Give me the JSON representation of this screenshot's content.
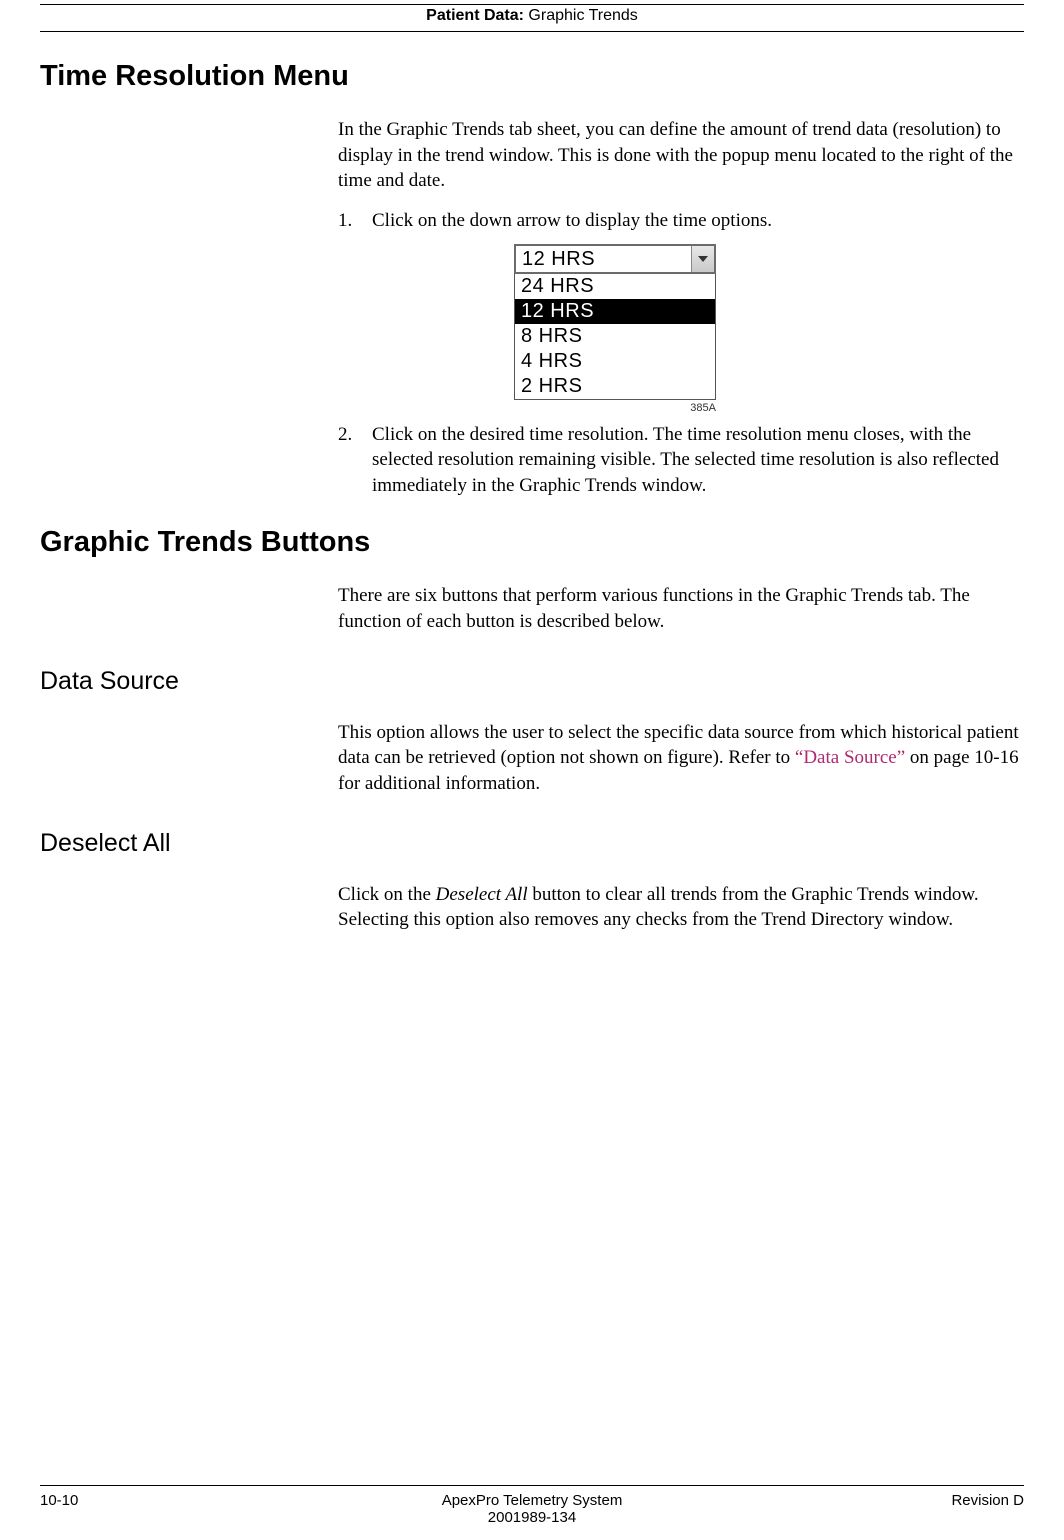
{
  "header": {
    "section_label": "Patient Data:",
    "section_value": "Graphic Trends"
  },
  "sections": {
    "time_resolution": {
      "title": "Time Resolution Menu",
      "intro": "In the Graphic Trends tab sheet, you can define the amount of trend data (resolution) to display in the trend window. This is done with the popup menu located to the right of the time and date.",
      "step1_num": "1.",
      "step1_text": "Click on the down arrow to display the time options.",
      "dropdown": {
        "selected": "12 HRS",
        "options": [
          "24 HRS",
          "12 HRS",
          "8 HRS",
          "4 HRS",
          "2 HRS"
        ],
        "highlighted_index": 1
      },
      "fig_caption": "385A",
      "step2_num": "2.",
      "step2_text": "Click on the desired time resolution. The time resolution menu closes, with the selected resolution remaining visible. The selected time resolution is also reflected immediately in the Graphic Trends window."
    },
    "graphic_trends_buttons": {
      "title": "Graphic Trends Buttons",
      "intro": "There are six buttons that perform various functions in the Graphic Trends tab. The function of each button is described below."
    },
    "data_source": {
      "title": "Data Source",
      "text_pre": "This option allows the user to select the specific data source from which historical patient data can be retrieved (option not  shown on figure). Refer to ",
      "link": "“Data Source”",
      "text_post": " on page 10-16 for additional information."
    },
    "deselect_all": {
      "title": "Deselect All",
      "text_pre": "Click on the ",
      "emph": "Deselect All",
      "text_post": " button to clear all trends from the Graphic Trends window. Selecting this option also removes any checks from the Trend Directory window."
    }
  },
  "footer": {
    "page_num": "10-10",
    "product": "ApexPro Telemetry System",
    "doc_num": "2001989-134",
    "revision": "Revision D"
  }
}
